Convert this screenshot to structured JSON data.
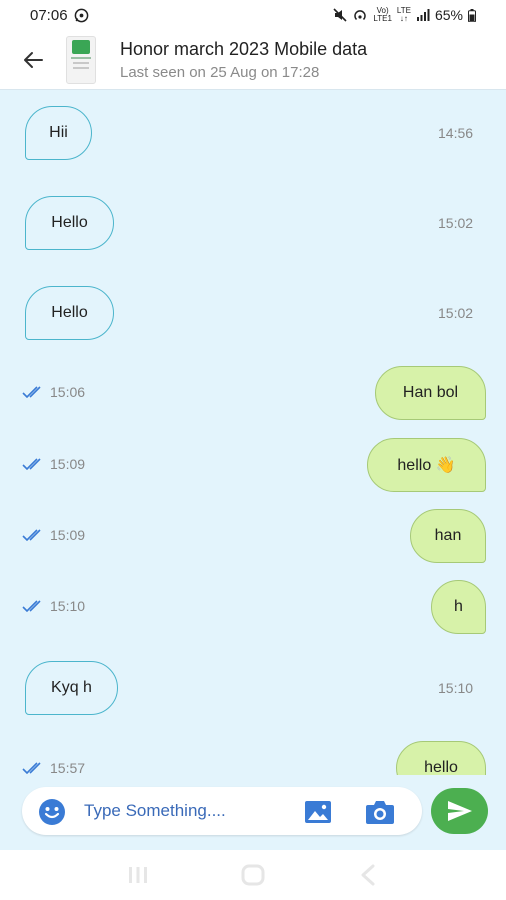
{
  "status_bar": {
    "time": "07:06",
    "battery": "65%",
    "net_top": "Vo)",
    "net_bottom": "LTE1",
    "net2_top": "LTE",
    "net2_bottom": "↓↑"
  },
  "header": {
    "name": "Honor march 2023 Mobile data",
    "last_seen": "Last seen on 25 Aug on 17:28"
  },
  "messages": [
    {
      "text": "Hii",
      "time": "14:56",
      "direction": "in"
    },
    {
      "text": "Hello",
      "time": "15:02",
      "direction": "in"
    },
    {
      "text": "Hello",
      "time": "15:02",
      "direction": "in"
    },
    {
      "text": "Han bol",
      "time": "15:06",
      "direction": "out"
    },
    {
      "text": "hello 👋",
      "time": "15:09",
      "direction": "out"
    },
    {
      "text": "han",
      "time": "15:09",
      "direction": "out"
    },
    {
      "text": "h",
      "time": "15:10",
      "direction": "out"
    },
    {
      "text": "Kyq h",
      "time": "15:10",
      "direction": "in"
    },
    {
      "text": "hello",
      "time": "15:57",
      "direction": "out"
    }
  ],
  "input": {
    "placeholder": "Type Something...."
  },
  "icons": {
    "back": "arrow-left",
    "emoji": "smiley-icon",
    "gallery": "image-icon",
    "camera": "camera-icon",
    "send": "send-arrow-icon",
    "read": "double-check-icon"
  },
  "colors": {
    "chat_bg": "#e3f4fc",
    "incoming_border": "#4bb5cc",
    "outgoing_bg": "#d7f2a9",
    "send_button": "#4caf50",
    "accent": "#3a6ab8"
  }
}
